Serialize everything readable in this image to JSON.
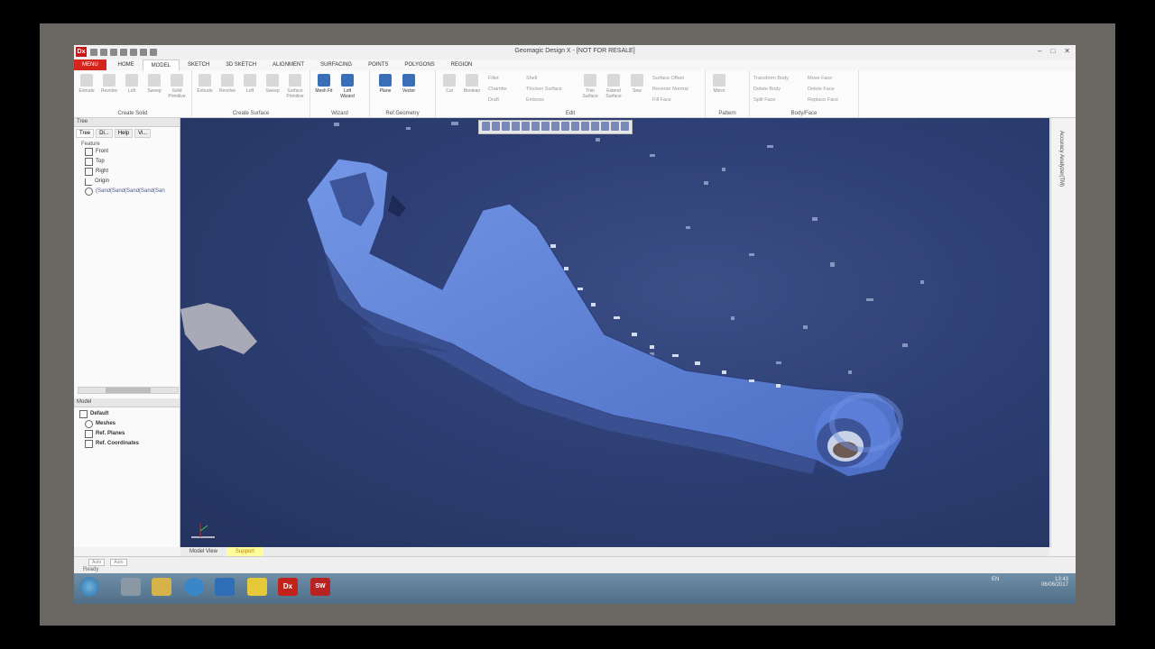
{
  "window": {
    "title": "Geomagic Design X - [NOT FOR RESALE]",
    "logo": "Dx"
  },
  "tabs": [
    "MENU",
    "HOME",
    "MODEL",
    "SKETCH",
    "3D SKETCH",
    "ALIGNMENT",
    "SURFACING",
    "POINTS",
    "POLYGONS",
    "REGION"
  ],
  "active_tab": "MODEL",
  "ribbon": {
    "create_solid": {
      "caption": "Create Solid",
      "buttons": [
        "Extrude",
        "Revolve",
        "Loft",
        "Sweep",
        "Solid Primitive"
      ]
    },
    "create_surface": {
      "caption": "Create Surface",
      "buttons": [
        "Extrude",
        "Revolve",
        "Loft",
        "Sweep",
        "Surface Primitive"
      ]
    },
    "wizard": {
      "caption": "Wizard",
      "buttons": [
        "Mesh Fit",
        "Loft Wizard"
      ]
    },
    "ref_geometry": {
      "caption": "Ref.Geometry",
      "buttons": [
        "Plane",
        "Vector"
      ]
    },
    "edit": {
      "caption": "Edit",
      "buttons": [
        "Cut",
        "Boolean",
        "Trim Surface",
        "Extend Surface",
        "Sew"
      ],
      "small_items": [
        "Fillet",
        "Chamfer",
        "Draft",
        "Shell",
        "Thicken Surface",
        "Emboss",
        "Surface Offset",
        "Reverse Normal",
        "Fill Face"
      ]
    },
    "pattern": {
      "caption": "Pattern",
      "buttons": [
        "Mirror"
      ]
    },
    "body_face": {
      "caption": "Body/Face",
      "small_items": [
        "Transform Body",
        "Delete Body",
        "Split Face",
        "Move Face",
        "Delete Face",
        "Replace Face"
      ]
    }
  },
  "feature_panel": {
    "header": "Tree",
    "tabs": [
      "Tree",
      "Di...",
      "Help",
      "Vi..."
    ],
    "section": "Feature",
    "items": [
      "Front",
      "Top",
      "Right",
      "Origin",
      "(Sand(Sand(Sand(Sand(San"
    ]
  },
  "model_panel": {
    "header": "Model",
    "items": [
      "Default",
      "Meshes",
      "Ref. Planes",
      "Ref. Coordinates"
    ]
  },
  "right_panel": {
    "label": "Accuracy Analyzer(TM)"
  },
  "view_tabs": [
    "Model View",
    "Support"
  ],
  "active_view_tab": "Support",
  "status": {
    "ready": "Ready",
    "selectors": [
      "Auto",
      "Auto"
    ]
  },
  "taskbar": {
    "apps": [
      "Dx",
      "SW"
    ],
    "lang": "EN",
    "time": "13:43",
    "date": "06/06/2017"
  },
  "colors": {
    "accent": "#d2261e",
    "mesh": "#5a7fd6",
    "viewport_bg": "#2d3f74",
    "support_tab": "#fffd9c"
  }
}
